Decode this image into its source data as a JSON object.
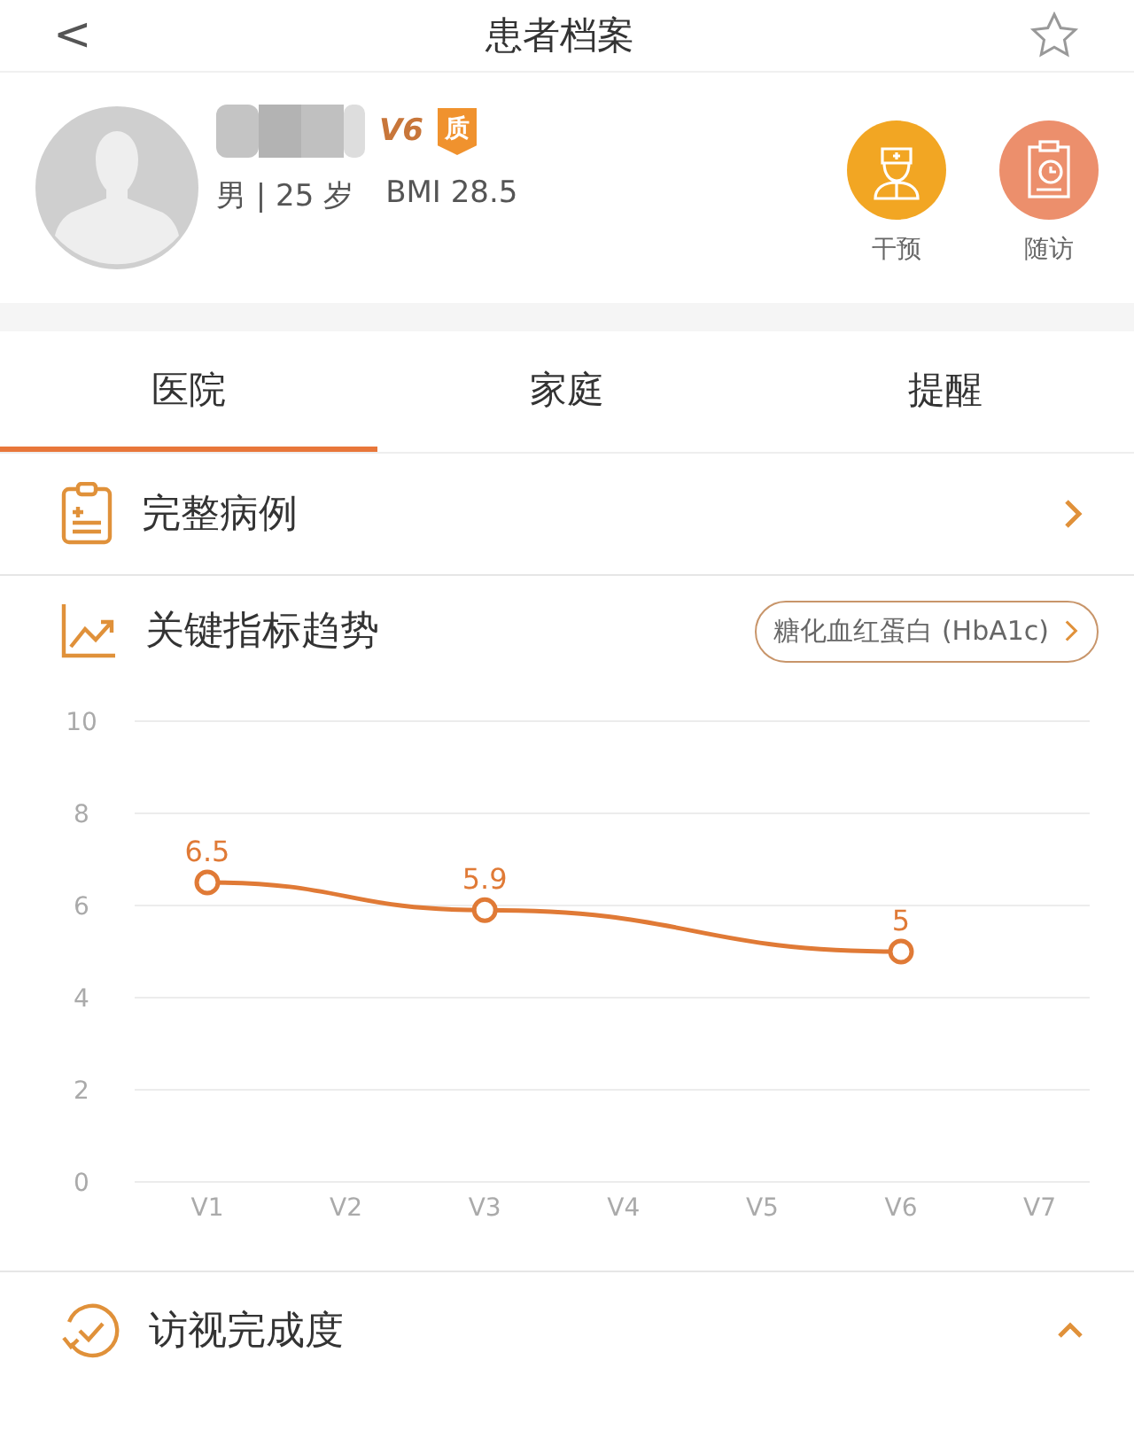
{
  "header": {
    "back": "<",
    "title": "患者档案",
    "favorite": false
  },
  "patient": {
    "level_badge": "V6",
    "quality_badge": "质",
    "info": "男 | 25 岁",
    "bmi": "BMI 28.5"
  },
  "actions": [
    {
      "label": "干预",
      "kind": "doctor"
    },
    {
      "label": "随访",
      "kind": "clipboard"
    }
  ],
  "tabs": [
    {
      "label": "医院",
      "selected": true
    },
    {
      "label": "家庭",
      "selected": false
    },
    {
      "label": "提醒",
      "selected": false
    }
  ],
  "record": {
    "label": "完整病例"
  },
  "trend": {
    "label": "关键指标趋势",
    "indicator": "糖化血红蛋白 (HbA1c)",
    "chart_data": {
      "type": "line",
      "grid": true,
      "categories": [
        "V1",
        "V2",
        "V3",
        "V4",
        "V5",
        "V6",
        "V7"
      ],
      "ylim": [
        0,
        10
      ],
      "yticks": [
        0,
        2,
        4,
        6,
        8,
        10
      ],
      "data_labels": true,
      "series": [
        {
          "color": "#e07a36",
          "marker": "circle",
          "values": [
            6.5,
            null,
            5.9,
            null,
            null,
            5,
            null
          ]
        }
      ]
    }
  },
  "completion": {
    "label": "访视完成度",
    "expanded": true
  }
}
